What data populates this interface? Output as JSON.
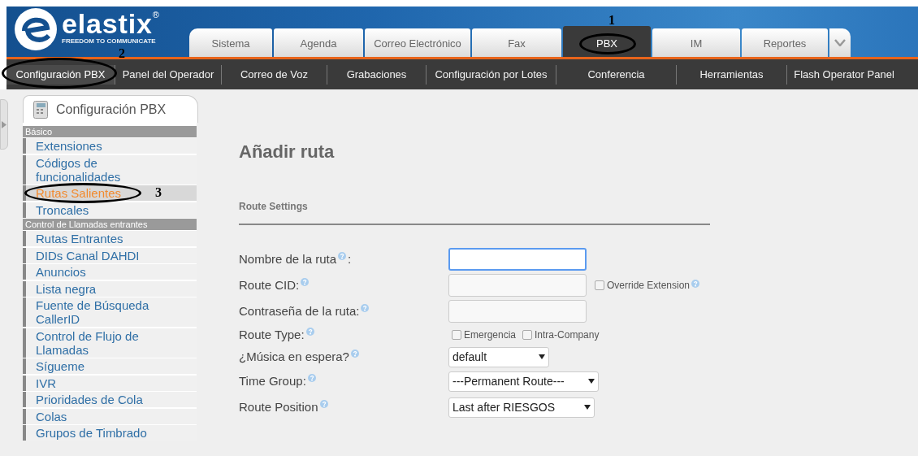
{
  "logo": {
    "name": "elastix",
    "registered": "®",
    "tagline": "FREEDOM TO COMMUNICATE"
  },
  "tabs": [
    {
      "label": "Sistema",
      "selected": false
    },
    {
      "label": "Agenda",
      "selected": false
    },
    {
      "label": "Correo Electrónico",
      "selected": false
    },
    {
      "label": "Fax",
      "selected": false
    },
    {
      "label": "PBX",
      "selected": true,
      "callout": "1"
    },
    {
      "label": "IM",
      "selected": false
    },
    {
      "label": "Reportes",
      "selected": false
    }
  ],
  "subnav": [
    {
      "label": "Configuración PBX",
      "selected": true,
      "callout": "2"
    },
    {
      "label": "Panel del Operador",
      "selected": false
    },
    {
      "label": "Correo de Voz",
      "selected": false
    },
    {
      "label": "Grabaciones",
      "selected": false
    },
    {
      "label": "Configuración por Lotes",
      "selected": false
    },
    {
      "label": "Conferencia",
      "selected": false
    },
    {
      "label": "Herramientas",
      "selected": false
    },
    {
      "label": "Flash Operator Panel",
      "selected": false
    }
  ],
  "sidebar": {
    "title": "Configuración PBX",
    "groups": [
      {
        "heading": "Básico",
        "items": [
          {
            "label": "Extensiones",
            "selected": false
          },
          {
            "label": "Códigos de funcionalidades",
            "selected": false
          },
          {
            "label": "Rutas Salientes",
            "selected": true,
            "callout": "3"
          },
          {
            "label": "Troncales",
            "selected": false
          }
        ]
      },
      {
        "heading": "Control de Llamadas entrantes",
        "items": [
          {
            "label": "Rutas Entrantes",
            "selected": false
          },
          {
            "label": "DIDs Canal DAHDI",
            "selected": false
          },
          {
            "label": "Anuncios",
            "selected": false
          },
          {
            "label": "Lista negra",
            "selected": false
          },
          {
            "label": "Fuente de Búsqueda CallerID",
            "selected": false
          },
          {
            "label": "Control de Flujo de Llamadas",
            "selected": false
          },
          {
            "label": "Sígueme",
            "selected": false
          },
          {
            "label": "IVR",
            "selected": false
          },
          {
            "label": "Prioridades de Cola",
            "selected": false
          },
          {
            "label": "Colas",
            "selected": false
          },
          {
            "label": "Grupos de Timbrado",
            "selected": false
          }
        ]
      }
    ]
  },
  "page_title": "Añadir ruta",
  "section_title": "Route Settings",
  "form": [
    {
      "kind": "text",
      "label": "Nombre de la ruta",
      "suffix": ":",
      "focused": true
    },
    {
      "kind": "text",
      "label": "Route CID:",
      "focused": false,
      "extra": {
        "label": "Override Extension",
        "checked": false
      }
    },
    {
      "kind": "text",
      "label": "Contraseña de la ruta:",
      "focused": false
    },
    {
      "kind": "checks",
      "label": "Route Type:",
      "options": [
        {
          "label": "Emergencia",
          "checked": false
        },
        {
          "label": "Intra-Company",
          "checked": false
        }
      ]
    },
    {
      "kind": "select",
      "label": "¿Música en espera?",
      "value": "default"
    },
    {
      "kind": "select",
      "label": "Time Group:",
      "value": "---Permanent Route---"
    },
    {
      "kind": "select",
      "label": "Route Position",
      "value": "Last after RIESGOS"
    }
  ]
}
